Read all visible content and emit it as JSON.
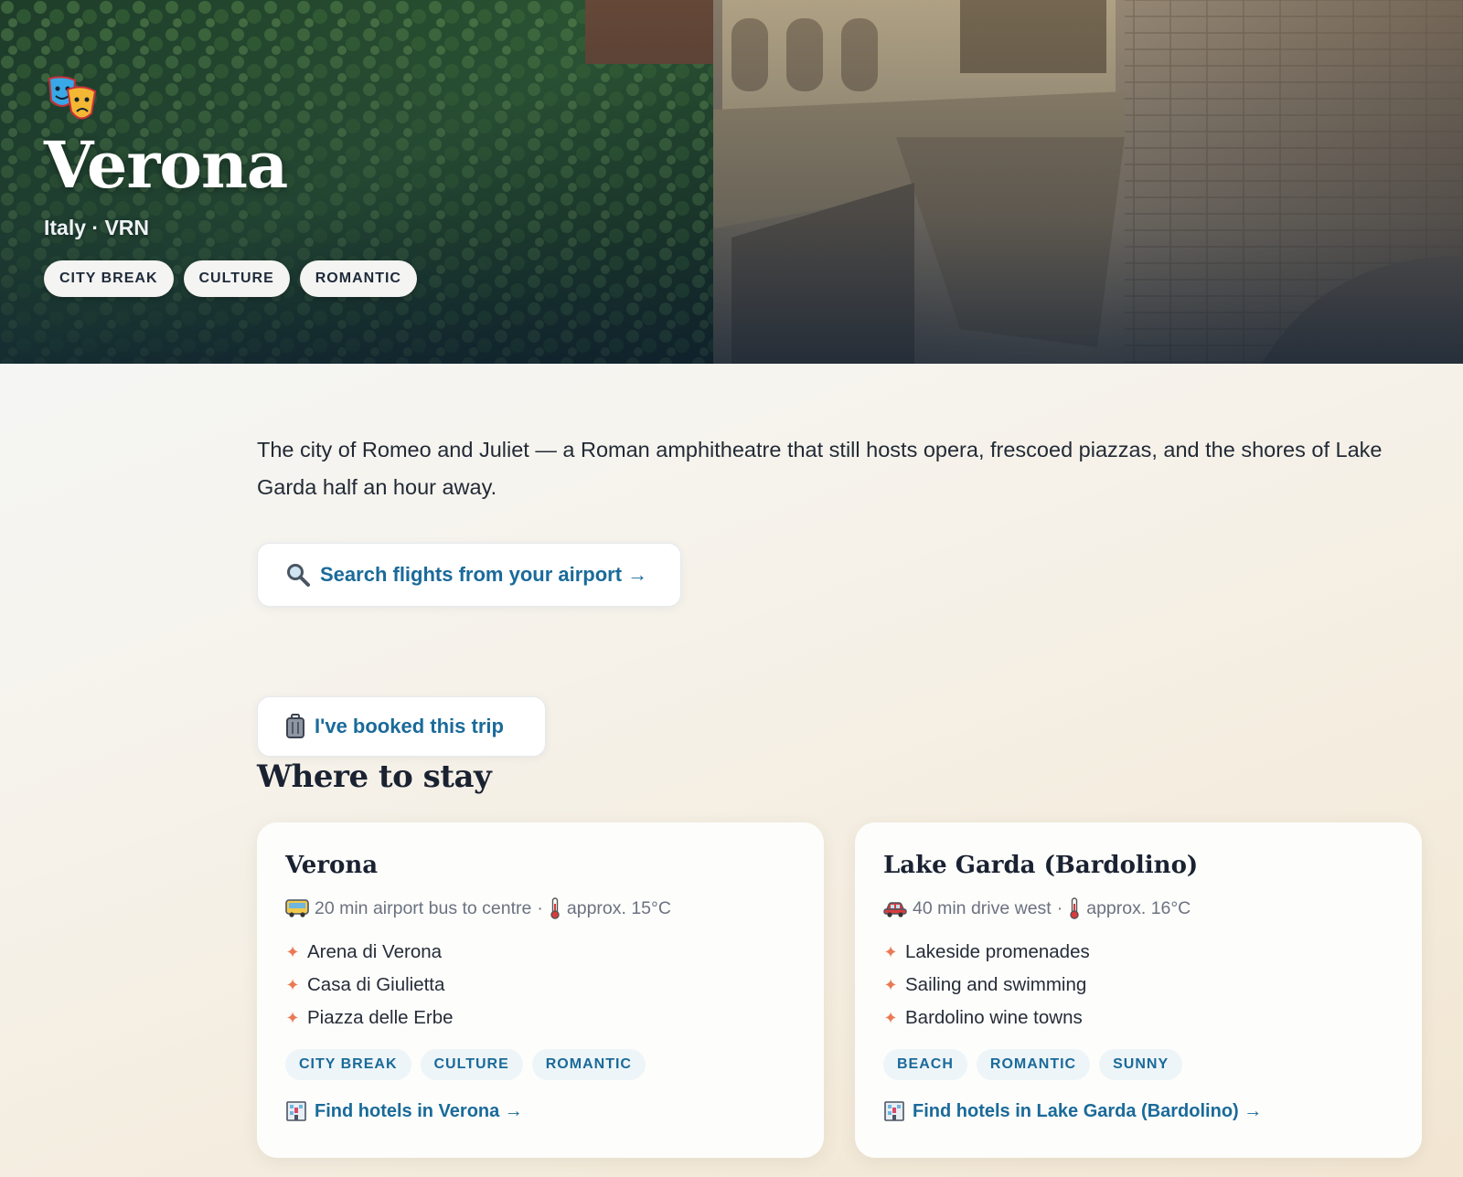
{
  "hero": {
    "title": "Verona",
    "subtitle": "Italy · VRN",
    "icon": "theatre-masks-icon",
    "tags": [
      "CITY BREAK",
      "CULTURE",
      "ROMANTIC"
    ]
  },
  "intro": "The city of Romeo and Juliet — a Roman amphitheatre that still hosts opera, frescoed piazzas, and the shores of Lake Garda half an hour away.",
  "actions": {
    "search_flights": "Search flights from your airport →",
    "booked": "I've booked this trip"
  },
  "stay": {
    "heading": "Where to stay",
    "cards": [
      {
        "name": "Verona",
        "transport_icon": "bus-icon",
        "transport": "20 min airport bus to centre",
        "temp": "approx. 15°C",
        "highlights": [
          "Arena di Verona",
          "Casa di Giulietta",
          "Piazza delle Erbe"
        ],
        "tags": [
          "CITY BREAK",
          "CULTURE",
          "ROMANTIC"
        ],
        "hotel_link": "Find hotels in Verona →"
      },
      {
        "name": "Lake Garda (Bardolino)",
        "transport_icon": "car-icon",
        "transport": "40 min drive west",
        "temp": "approx. 16°C",
        "highlights": [
          "Lakeside promenades",
          "Sailing and swimming",
          "Bardolino wine towns"
        ],
        "tags": [
          "BEACH",
          "ROMANTIC",
          "SUNNY"
        ],
        "hotel_link": "Find hotels in Lake Garda (Bardolino) →"
      }
    ]
  },
  "colors": {
    "link": "#1a6a9a",
    "accent_star": "#ea7a55",
    "tag_bg": "#eef5f8"
  }
}
